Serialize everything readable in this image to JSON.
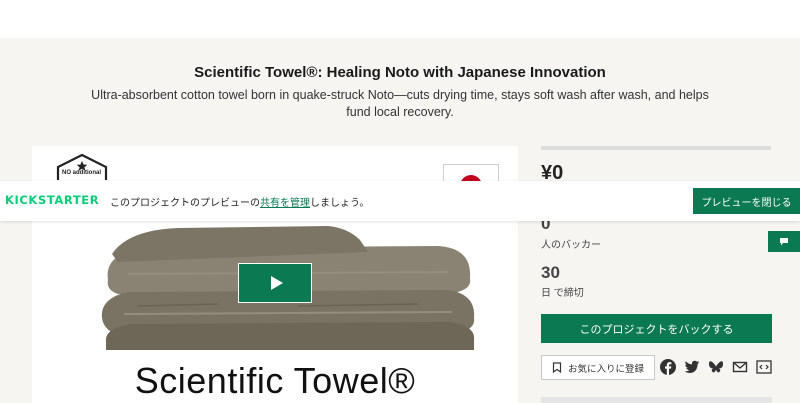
{
  "project": {
    "title": "Scientific Towel®: Healing Noto with Japanese Innovation",
    "subtitle": "Ultra-absorbent cotton towel born in quake-struck Noto—cuts drying time, stays soft wash after wash, and helps fund local recovery."
  },
  "media": {
    "badge_text": "NO additional",
    "product_name": "Scientific Towel®",
    "play_icon": "play-icon"
  },
  "stats": {
    "pledged": "¥0",
    "backers_count": "0",
    "backers_label": "人のバッカー",
    "days_count": "30",
    "days_label": "日 で締切"
  },
  "actions": {
    "back_label": "このプロジェクトをバックする",
    "favorite_label": "お気に入りに登録",
    "share_icons": [
      "facebook-icon",
      "twitter-icon",
      "bluesky-icon",
      "email-icon",
      "embed-icon"
    ]
  },
  "preview_banner": {
    "logo": "KICKSTARTER",
    "text_before": "このプロジェクトのプレビューの",
    "manage_link": "共有を管理",
    "text_after": "しましょう。",
    "close_label": "プレビューを閉じる"
  },
  "colors": {
    "accent": "#0b7a52",
    "brand": "#05ce78",
    "flag_red": "#c2001f",
    "background": "#f6f5f2"
  }
}
